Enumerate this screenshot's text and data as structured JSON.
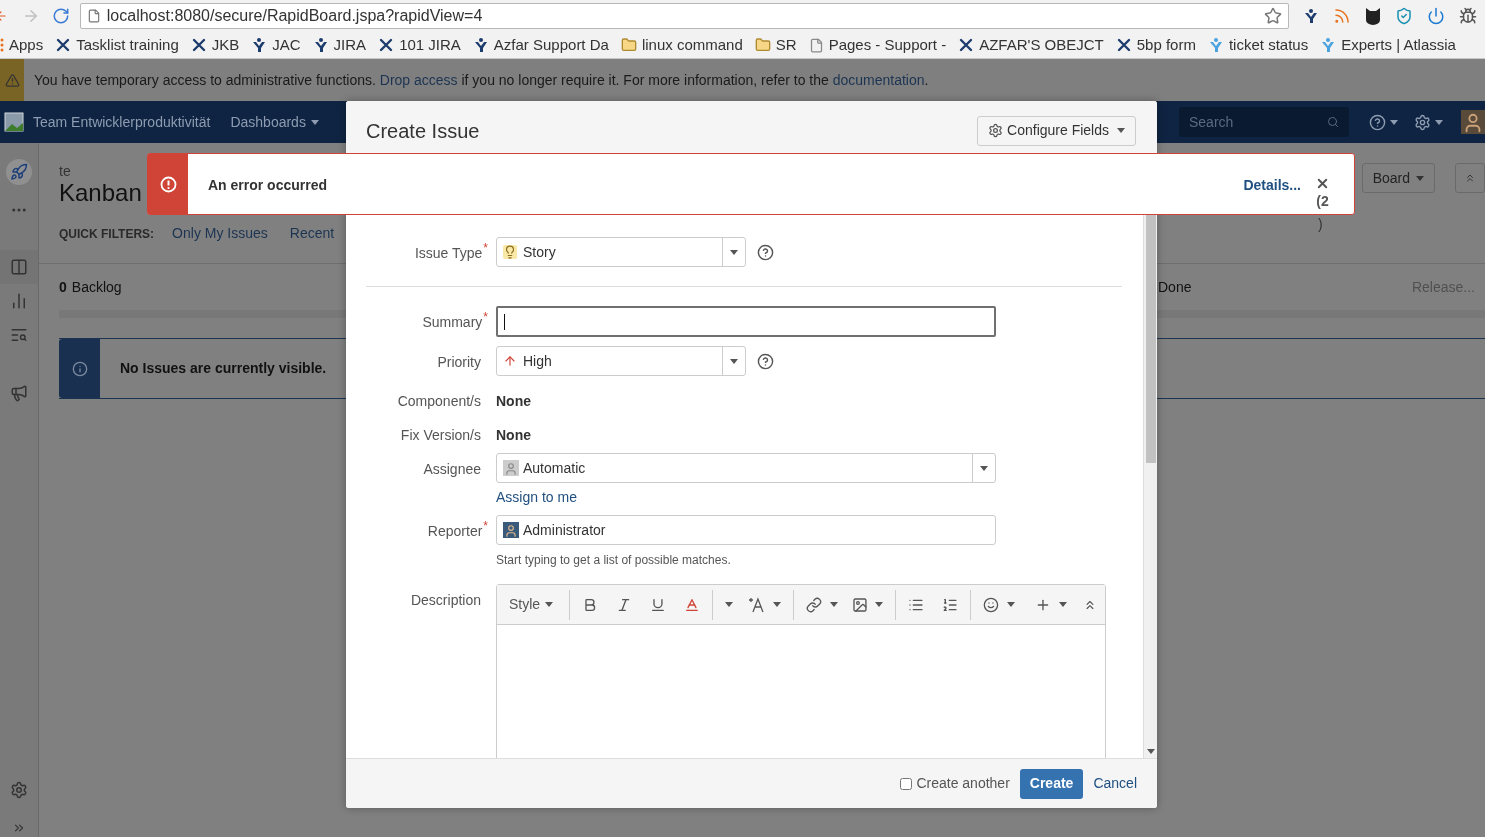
{
  "browser": {
    "url": "localhost:8080/secure/RapidBoard.jspa?rapidView=4",
    "bookmarks": [
      {
        "label": "Apps",
        "kind": "apps"
      },
      {
        "label": "Tasklist training",
        "kind": "tool"
      },
      {
        "label": "JKB",
        "kind": "tool"
      },
      {
        "label": "JAC",
        "kind": "figure"
      },
      {
        "label": "JIRA",
        "kind": "figure"
      },
      {
        "label": "101 JIRA",
        "kind": "tool"
      },
      {
        "label": "Azfar Support Da",
        "kind": "figure"
      },
      {
        "label": "linux command",
        "kind": "folder"
      },
      {
        "label": "SR",
        "kind": "folder"
      },
      {
        "label": "Pages - Support -",
        "kind": "page"
      },
      {
        "label": "AZFAR'S OBEJCT",
        "kind": "tool"
      },
      {
        "label": "5bp form",
        "kind": "tool"
      },
      {
        "label": "ticket status",
        "kind": "light"
      },
      {
        "label": "Experts | Atlassia",
        "kind": "light"
      }
    ]
  },
  "admin_banner": {
    "parts": [
      {
        "text": "You have temporary access to administrative functions. ",
        "link": false
      },
      {
        "text": "Drop access",
        "link": true
      },
      {
        "text": " if you no longer require it. For more information, refer to the ",
        "link": false
      },
      {
        "text": "documentation",
        "link": true
      },
      {
        "text": ".",
        "link": false
      }
    ]
  },
  "header": {
    "title": "Team Entwicklerproduktivität",
    "menus": [
      "Dashboards"
    ],
    "search": {
      "placeholder": "Search"
    }
  },
  "board": {
    "project": "te",
    "title": "Kanban",
    "quick_filters_label": "QUICK FILTERS:",
    "quick_filters": [
      "Only My Issues",
      "Recent"
    ],
    "board_button": "Board",
    "columns": [
      {
        "count": "0",
        "name": "Backlog"
      },
      {
        "name": "Done"
      }
    ],
    "release": "Release...",
    "empty_message": "No Issues are currently visible."
  },
  "error": {
    "title": "An error occurred",
    "details": "Details...",
    "count_start": "(2",
    "count_end": ")"
  },
  "dialog": {
    "title": "Create Issue",
    "configure": "Configure Fields",
    "required_mark": "*",
    "fields": [
      {
        "kind": "select",
        "label": "Issue Type",
        "required": true,
        "value": "Story"
      },
      {
        "kind": "text",
        "label": "Summary",
        "required": true,
        "focused": true,
        "divider_before": true
      },
      {
        "kind": "select",
        "label": "Priority",
        "required": false,
        "value": "High"
      },
      {
        "kind": "static",
        "label": "Component/s",
        "required": false,
        "value": "None"
      },
      {
        "kind": "static",
        "label": "Fix Version/s",
        "required": false,
        "value": "None"
      },
      {
        "kind": "user-select",
        "label": "Assignee",
        "required": false,
        "value": "Automatic",
        "link": "Assign to me"
      },
      {
        "kind": "user",
        "label": "Reporter",
        "required": true,
        "value": "Administrator",
        "hint": "Start typing to get a list of possible matches."
      },
      {
        "kind": "editor",
        "label": "Description",
        "required": false,
        "style": "Style"
      }
    ],
    "create_another": {
      "label": "Create another",
      "checked": false
    },
    "submit": "Create",
    "cancel": "Cancel"
  }
}
